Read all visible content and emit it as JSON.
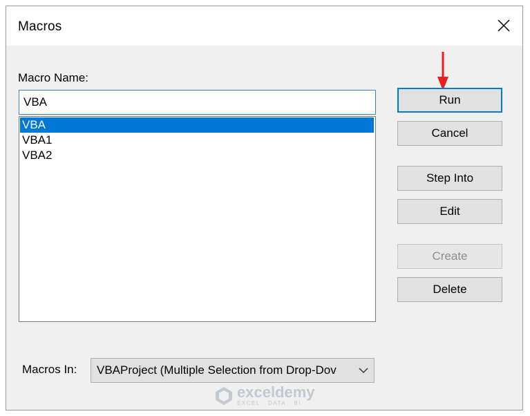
{
  "window": {
    "title": "Macros"
  },
  "macro_name": {
    "label": "Macro Name:",
    "value": "VBA"
  },
  "macro_list": {
    "items": [
      {
        "label": "VBA",
        "selected": true
      },
      {
        "label": "VBA1",
        "selected": false
      },
      {
        "label": "VBA2",
        "selected": false
      }
    ]
  },
  "buttons": {
    "run": "Run",
    "cancel": "Cancel",
    "step_into": "Step Into",
    "edit": "Edit",
    "create": "Create",
    "delete": "Delete"
  },
  "macros_in": {
    "label": "Macros In:",
    "value": "VBAProject (Multiple Selection from Drop-Dov"
  },
  "watermark": {
    "brand": "exceldemy",
    "tagline": "EXCEL · DATA · BI"
  },
  "icons": {
    "close": "close-icon",
    "dropdown": "chevron-down-icon",
    "annotation_arrow": "red-arrow-down-icon",
    "watermark_logo": "exceldemy-logo-icon"
  },
  "colors": {
    "selection": "#0078d7",
    "default_button_border": "#0078d7",
    "annotation_arrow": "#e8201c",
    "dialog_bg": "#f0f0f0"
  }
}
